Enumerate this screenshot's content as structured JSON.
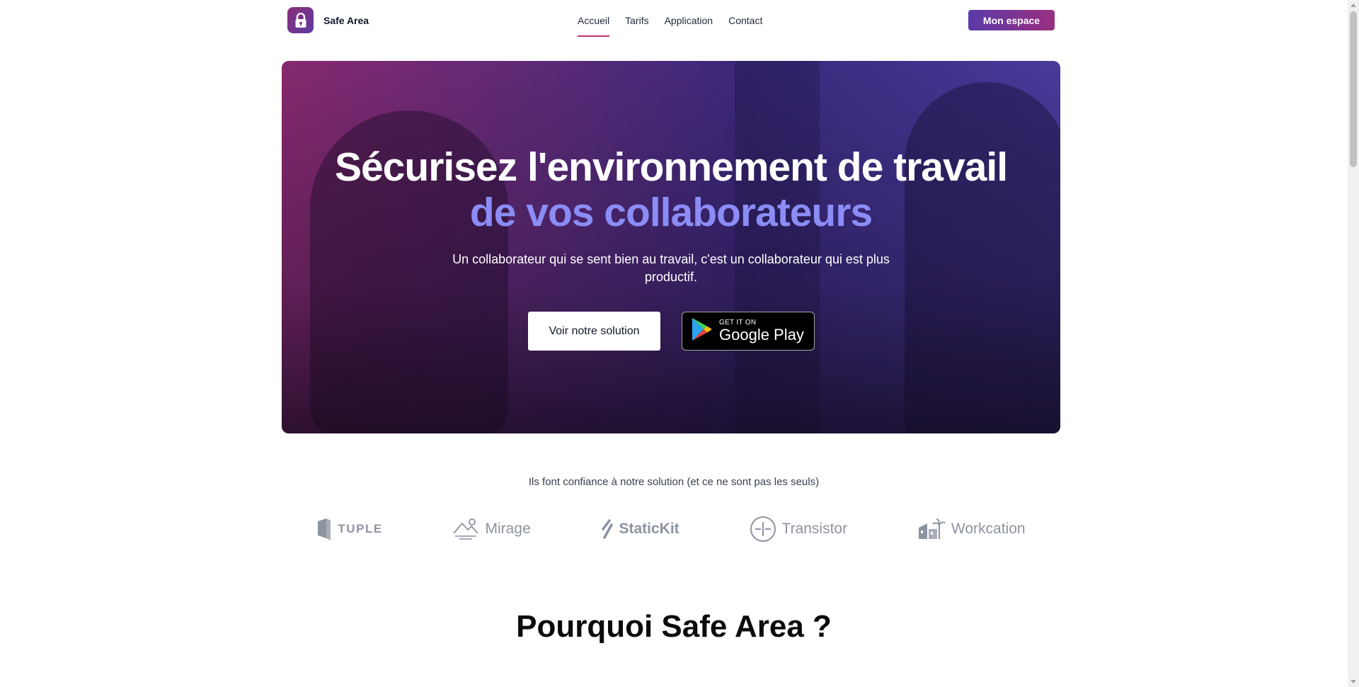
{
  "header": {
    "brand_name": "Safe Area",
    "nav": [
      {
        "label": "Accueil",
        "active": true
      },
      {
        "label": "Tarifs",
        "active": false
      },
      {
        "label": "Application",
        "active": false
      },
      {
        "label": "Contact",
        "active": false
      }
    ],
    "cta_label": "Mon espace"
  },
  "hero": {
    "title_line1": "Sécurisez l'environnement de travail",
    "title_line2": "de vos collaborateurs",
    "subtitle": "Un collaborateur qui se sent bien au travail, c'est un collaborateur qui est plus productif.",
    "primary_button": "Voir notre solution",
    "store_badge": {
      "small": "GET IT ON",
      "big": "Google Play"
    }
  },
  "trust": {
    "heading": "Ils font confiance à notre solution (et ce ne sont pas les seuls)",
    "logos": [
      "TUPLE",
      "Mirage",
      "StaticKit",
      "Transistor",
      "Workcation"
    ]
  },
  "why": {
    "heading": "Pourquoi Safe Area ?"
  },
  "colors": {
    "accent_purple": "#5b3aa8",
    "accent_magenta": "#9a2f7f",
    "title_highlight": "#8b8cf5",
    "nav_underline": "#c0306a"
  }
}
